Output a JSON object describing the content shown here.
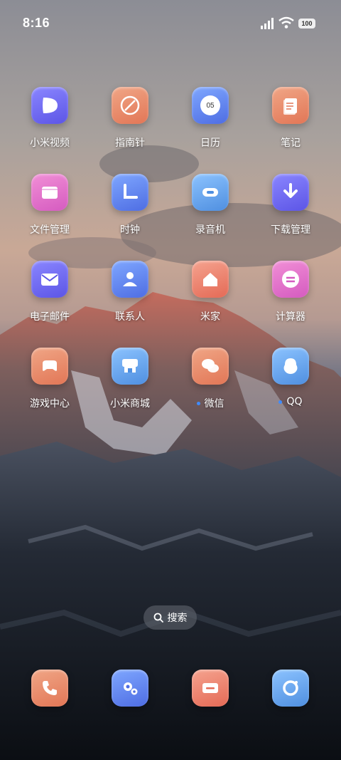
{
  "status_bar": {
    "time": "8:16",
    "battery": "100",
    "icons": [
      "signal-icon",
      "wifi-icon",
      "battery-icon"
    ]
  },
  "apps": [
    {
      "label": "小米视频",
      "icon": "video-play-icon",
      "color": "#6e67f2",
      "dot": false
    },
    {
      "label": "指南针",
      "icon": "compass-icon",
      "color": "#e88a6a",
      "dot": false
    },
    {
      "label": "日历",
      "icon": "calendar-icon",
      "color": "#5e7cf0",
      "dot": false,
      "badge": "05"
    },
    {
      "label": "笔记",
      "icon": "notes-icon",
      "color": "#e88a6a",
      "dot": false
    },
    {
      "label": "文件管理",
      "icon": "folder-icon",
      "color": "#e070cb",
      "dot": false
    },
    {
      "label": "时钟",
      "icon": "clock-icon",
      "color": "#5e7cf0",
      "dot": false
    },
    {
      "label": "录音机",
      "icon": "recorder-icon",
      "color": "#5e9be8",
      "dot": false
    },
    {
      "label": "下载管理",
      "icon": "download-icon",
      "color": "#6e67f2",
      "dot": false
    },
    {
      "label": "电子邮件",
      "icon": "mail-icon",
      "color": "#6e67f2",
      "dot": false
    },
    {
      "label": "联系人",
      "icon": "contacts-icon",
      "color": "#5e7cf0",
      "dot": false
    },
    {
      "label": "米家",
      "icon": "home-icon",
      "color": "#e88a6a",
      "dot": false
    },
    {
      "label": "计算器",
      "icon": "calculator-icon",
      "color": "#e070cb",
      "dot": false
    },
    {
      "label": "游戏中心",
      "icon": "gamepad-icon",
      "color": "#e88a6a",
      "dot": false
    },
    {
      "label": "小米商城",
      "icon": "store-icon",
      "color": "#5e9be8",
      "dot": false
    },
    {
      "label": "微信",
      "icon": "wechat-icon",
      "color": "#e88a6a",
      "dot": true
    },
    {
      "label": "QQ",
      "icon": "qq-icon",
      "color": "#5e9be8",
      "dot": true
    }
  ],
  "search": {
    "label": "搜索"
  },
  "dock": [
    {
      "icon": "phone-icon",
      "color": "#e88a6a"
    },
    {
      "icon": "settings-icon",
      "color": "#5e7cf0"
    },
    {
      "icon": "messages-icon",
      "color": "#e88a6a"
    },
    {
      "icon": "camera-icon",
      "color": "#5e9be8"
    }
  ]
}
